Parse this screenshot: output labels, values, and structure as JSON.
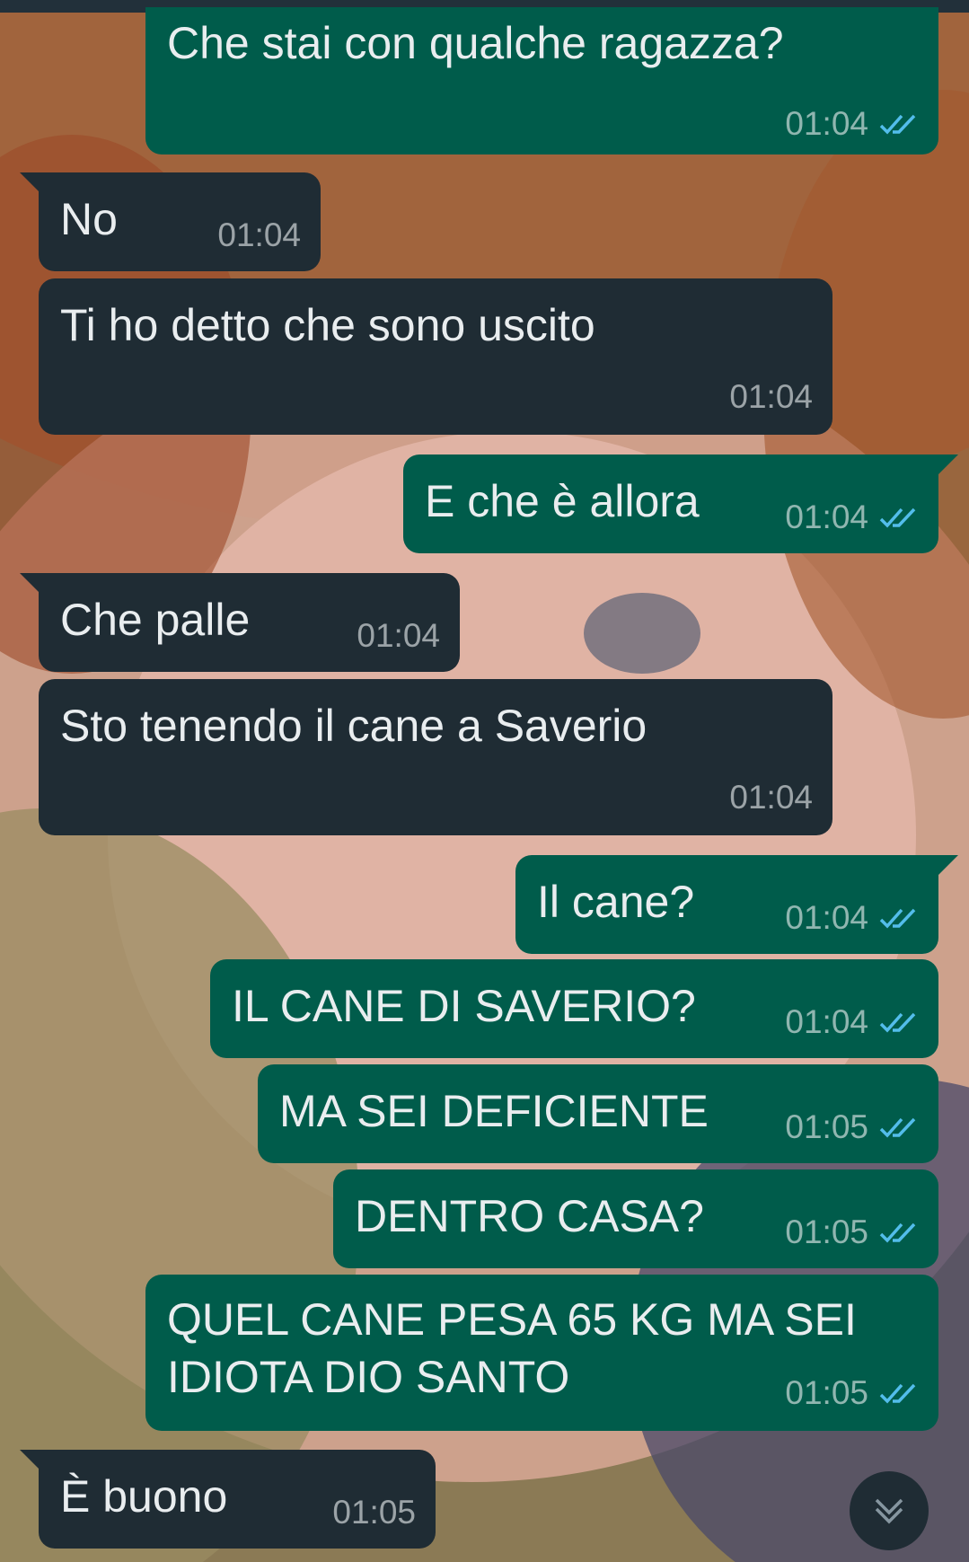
{
  "colors": {
    "incoming_bubble": "#1f2c34",
    "outgoing_bubble": "#005c4b",
    "text": "#e9edef",
    "read_tick": "#53bdeb"
  },
  "icons": {
    "read_receipt": "double-check-icon",
    "scroll_down": "double-chevron-down-icon"
  },
  "messages": [
    {
      "dir": "out",
      "text": "Che stai con qualche ragazza?",
      "time": "01:04",
      "status": "read"
    },
    {
      "dir": "in",
      "text": "No",
      "time": "01:04"
    },
    {
      "dir": "in",
      "text": "Ti ho detto che sono uscito",
      "time": "01:04"
    },
    {
      "dir": "out",
      "text": "E che è allora",
      "time": "01:04",
      "status": "read"
    },
    {
      "dir": "in",
      "text": "Che palle",
      "time": "01:04"
    },
    {
      "dir": "in",
      "text": "Sto tenendo il cane a Saverio",
      "time": "01:04"
    },
    {
      "dir": "out",
      "text": "Il cane?",
      "time": "01:04",
      "status": "read"
    },
    {
      "dir": "out",
      "text": "IL CANE DI SAVERIO?",
      "time": "01:04",
      "status": "read"
    },
    {
      "dir": "out",
      "text": "MA SEI DEFICIENTE",
      "time": "01:05",
      "status": "read"
    },
    {
      "dir": "out",
      "text": "DENTRO CASA?",
      "time": "01:05",
      "status": "read"
    },
    {
      "dir": "out",
      "text": "QUEL CANE PESA 65 KG MA SEI\nIDIOTA DIO SANTO",
      "time": "01:05",
      "status": "read"
    },
    {
      "dir": "in",
      "text": "È buono",
      "time": "01:05"
    }
  ]
}
